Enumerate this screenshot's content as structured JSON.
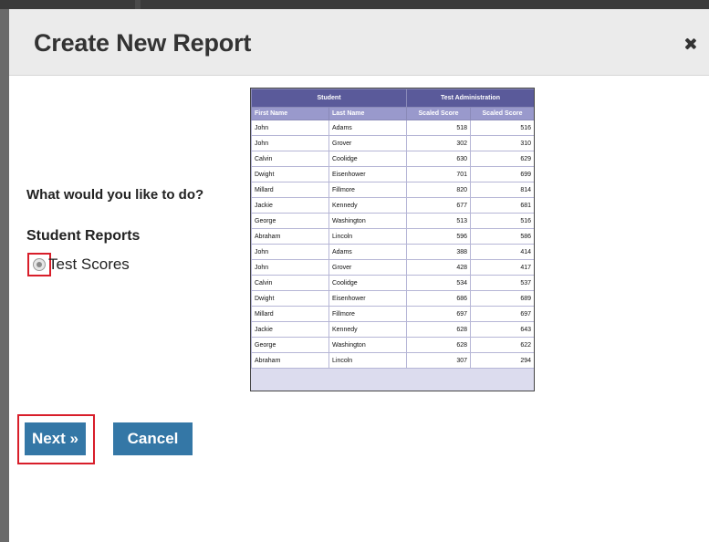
{
  "dialog": {
    "title": "Create New Report",
    "close_icon": "close-icon"
  },
  "form": {
    "question": "What would you like to do?",
    "section_label": "Student Reports",
    "options": [
      {
        "label": "Test Scores",
        "selected": true
      }
    ]
  },
  "preview": {
    "group_headers": [
      "Student",
      "Test Administration"
    ],
    "columns": [
      "First Name",
      "Last Name",
      "Scaled Score",
      "Scaled Score"
    ],
    "rows": [
      [
        "John",
        "Adams",
        "518",
        "516"
      ],
      [
        "John",
        "Grover",
        "302",
        "310"
      ],
      [
        "Calvin",
        "Coolidge",
        "630",
        "629"
      ],
      [
        "Dwight",
        "Eisenhower",
        "701",
        "699"
      ],
      [
        "Millard",
        "Fillmore",
        "820",
        "814"
      ],
      [
        "Jackie",
        "Kennedy",
        "677",
        "681"
      ],
      [
        "George",
        "Washington",
        "513",
        "516"
      ],
      [
        "Abraham",
        "Lincoln",
        "596",
        "586"
      ],
      [
        "John",
        "Adams",
        "388",
        "414"
      ],
      [
        "John",
        "Grover",
        "428",
        "417"
      ],
      [
        "Calvin",
        "Coolidge",
        "534",
        "537"
      ],
      [
        "Dwight",
        "Eisenhower",
        "686",
        "689"
      ],
      [
        "Millard",
        "Fillmore",
        "697",
        "697"
      ],
      [
        "Jackie",
        "Kennedy",
        "628",
        "643"
      ],
      [
        "George",
        "Washington",
        "628",
        "622"
      ],
      [
        "Abraham",
        "Lincoln",
        "307",
        "294"
      ]
    ]
  },
  "buttons": {
    "next_label": "Next »",
    "cancel_label": "Cancel"
  },
  "colors": {
    "button_bg": "#3477a6",
    "highlight": "#d81e2a",
    "table_header": "#5a5a9a",
    "table_subheader": "#9999cc"
  }
}
